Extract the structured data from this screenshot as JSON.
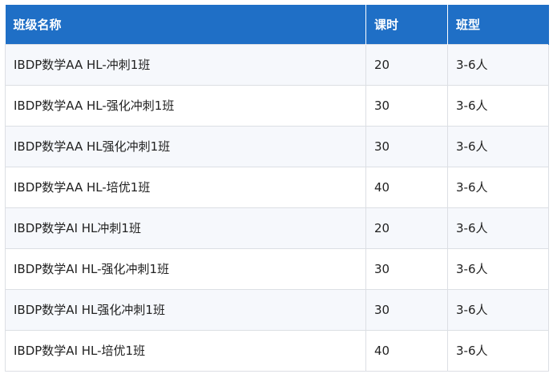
{
  "table": {
    "headers": {
      "name": "班级名称",
      "hours": "课时",
      "type": "班型"
    },
    "rows": [
      {
        "name": "IBDP数学AA HL-冲刺1班",
        "hours": "20",
        "type": "3-6人"
      },
      {
        "name": "IBDP数学AA HL-强化冲刺1班",
        "hours": "30",
        "type": "3-6人"
      },
      {
        "name": "IBDP数学AA HL强化冲刺1班",
        "hours": "30",
        "type": "3-6人"
      },
      {
        "name": "IBDP数学AA HL-培优1班",
        "hours": "40",
        "type": "3-6人"
      },
      {
        "name": "IBDP数学AI HL冲刺1班",
        "hours": "20",
        "type": "3-6人"
      },
      {
        "name": "IBDP数学AI HL-强化冲刺1班",
        "hours": "30",
        "type": "3-6人"
      },
      {
        "name": "IBDP数学AI HL强化冲刺1班",
        "hours": "30",
        "type": "3-6人"
      },
      {
        "name": "IBDP数学AI HL-培优1班",
        "hours": "40",
        "type": "3-6人"
      }
    ]
  },
  "colors": {
    "header_bg": "#1f6fc6",
    "header_text": "#ffffff",
    "row_stripe": "#f6f8fc",
    "border": "#dcdfe4"
  }
}
